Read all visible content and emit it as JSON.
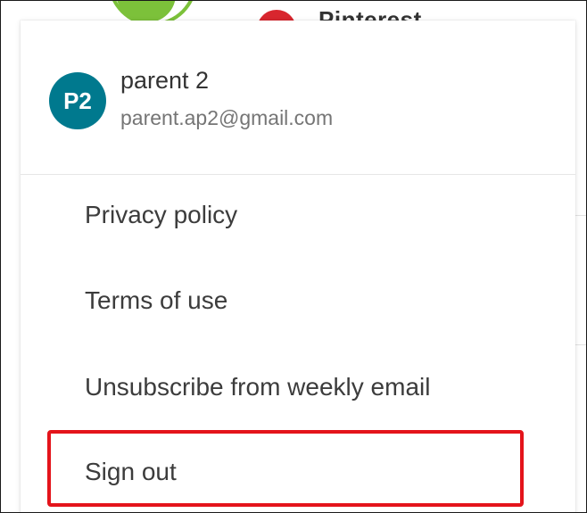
{
  "background": {
    "pinterest_label": "Pinterest",
    "pinterest_color": "#d8262e",
    "green_icon_color": "#7cc13a"
  },
  "account": {
    "avatar_initials": "P2",
    "avatar_color": "#00798e",
    "name": "parent 2",
    "email": "parent.ap2@gmail.com"
  },
  "menu": {
    "items": [
      {
        "label": "Privacy policy"
      },
      {
        "label": "Terms of use"
      },
      {
        "label": "Unsubscribe from weekly email"
      },
      {
        "label": "Sign out"
      }
    ]
  },
  "highlight": {
    "color": "#e4141b"
  }
}
